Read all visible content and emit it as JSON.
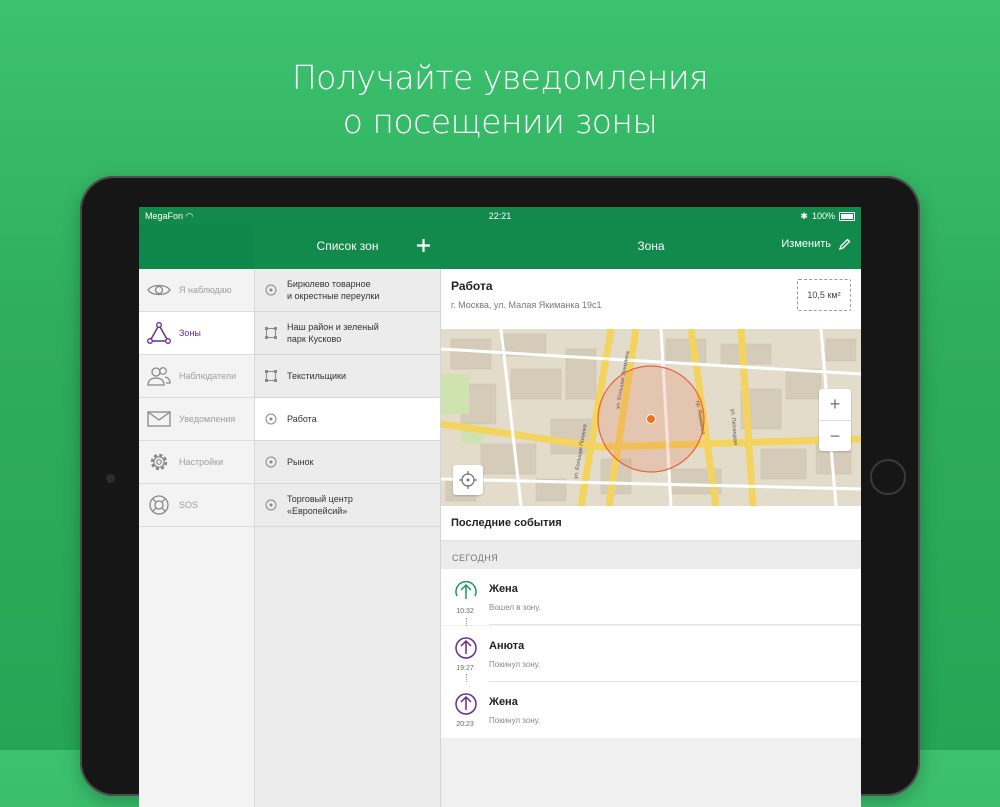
{
  "headline": {
    "line1": "Получайте уведомления",
    "line2": "о посещении зоны"
  },
  "status": {
    "carrier": "MegaFon",
    "time": "22:21",
    "battery": "100%"
  },
  "nav": {
    "zones_list_title": "Список зон",
    "zone_title": "Зона",
    "edit_label": "Изменить"
  },
  "menu": [
    {
      "label": "Я наблюдаю",
      "icon": "eye-icon"
    },
    {
      "label": "Зоны",
      "icon": "zones-icon",
      "active": true
    },
    {
      "label": "Наблюдатели",
      "icon": "people-icon"
    },
    {
      "label": "Уведомления",
      "icon": "envelope-icon"
    },
    {
      "label": "Настройки",
      "icon": "gear-icon"
    },
    {
      "label": "SOS",
      "icon": "lifebuoy-icon"
    }
  ],
  "zones": [
    {
      "label": "Бирюлево товарное\nи окрестные переулки",
      "type": "circle"
    },
    {
      "label": "Наш район и зеленый\nпарк Кусково",
      "type": "polygon"
    },
    {
      "label": "Текстильщики",
      "type": "polygon"
    },
    {
      "label": "Работа",
      "type": "circle",
      "active": true
    },
    {
      "label": "Рынок",
      "type": "circle"
    },
    {
      "label": "Торговый центр\n«Европейсий»",
      "type": "circle"
    }
  ],
  "zone": {
    "name": "Работа",
    "address": "г. Москва, ул. Малая Якиманка 19с1",
    "area": "10,5 км²"
  },
  "map": {
    "zoom_in": "+",
    "zoom_out": "−",
    "street_labels": [
      "ул. Большая Полянка",
      "ул. Большая Якиманка",
      "пр. Якиманка",
      "ул. Пятницкая"
    ]
  },
  "events": {
    "title": "Последние события",
    "day": "СЕГОДНЯ",
    "items": [
      {
        "name": "Жена",
        "text": "Вошел в зону.",
        "time": "10:32",
        "kind": "enter",
        "color": "#1a9a5a"
      },
      {
        "name": "Анюта",
        "text": "Покинул зону.",
        "time": "19:27",
        "kind": "leave",
        "color": "#6b2a8c"
      },
      {
        "name": "Жена",
        "text": "Покинул зону.",
        "time": "20:23",
        "kind": "leave",
        "color": "#6b2a8c"
      }
    ]
  },
  "colors": {
    "brand_green": "#118a4b",
    "accent_purple": "#6b2a8c",
    "zone_circle": "#e8623a"
  }
}
